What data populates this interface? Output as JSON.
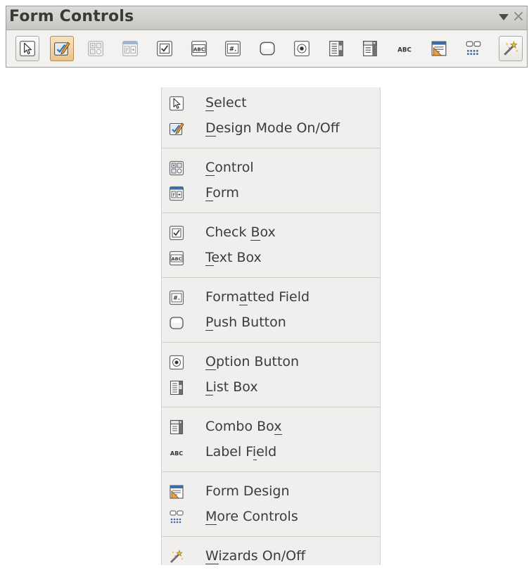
{
  "toolbar": {
    "title": "Form Controls",
    "menu_icon": "dropdown-arrow-icon",
    "close_icon": "close-icon",
    "buttons": [
      {
        "icon": "select-pointer-icon",
        "state": "normal"
      },
      {
        "icon": "design-mode-icon",
        "state": "pressed"
      },
      {
        "icon": "control-icon",
        "state": "disabled"
      },
      {
        "icon": "form-icon",
        "state": "disabled"
      },
      {
        "icon": "check-box-icon",
        "state": "normal"
      },
      {
        "icon": "text-box-icon",
        "state": "normal"
      },
      {
        "icon": "formatted-field-icon",
        "state": "normal"
      },
      {
        "icon": "push-button-icon",
        "state": "normal"
      },
      {
        "icon": "option-button-icon",
        "state": "normal"
      },
      {
        "icon": "list-box-icon",
        "state": "normal"
      },
      {
        "icon": "combo-box-icon",
        "state": "normal"
      },
      {
        "icon": "label-field-icon",
        "state": "normal"
      },
      {
        "icon": "form-design-icon",
        "state": "normal"
      },
      {
        "icon": "more-controls-icon",
        "state": "normal"
      },
      {
        "icon": "wizards-icon",
        "state": "boxed"
      }
    ],
    "label_field_glyph": "ABC",
    "text_box_glyph": "ABC"
  },
  "menu": {
    "items": [
      {
        "label": "Select",
        "icon": "select-pointer-icon",
        "mnemonic": "S"
      },
      {
        "label": "Design Mode On/Off",
        "icon": "design-mode-icon",
        "mnemonic": "D"
      },
      {
        "label": "Control",
        "icon": "control-icon",
        "mnemonic": "C"
      },
      {
        "label": "Form",
        "icon": "form-icon",
        "mnemonic": "F"
      },
      {
        "label": "Check Box",
        "icon": "check-box-icon",
        "mnemonic": "B"
      },
      {
        "label": "Text Box",
        "icon": "text-box-icon",
        "mnemonic": "T"
      },
      {
        "label": "Formatted Field",
        "icon": "formatted-field-icon",
        "mnemonic": "a"
      },
      {
        "label": "Push Button",
        "icon": "push-button-icon",
        "mnemonic": "P"
      },
      {
        "label": "Option Button",
        "icon": "option-button-icon",
        "mnemonic": "O"
      },
      {
        "label": "List Box",
        "icon": "list-box-icon",
        "mnemonic": "L"
      },
      {
        "label": "Combo Box",
        "icon": "combo-box-icon",
        "mnemonic": "x"
      },
      {
        "label": "Label Field",
        "icon": "label-field-icon",
        "mnemonic": "i"
      },
      {
        "label": "Form Design",
        "icon": "form-design-icon",
        "mnemonic": ""
      },
      {
        "label": "More Controls",
        "icon": "more-controls-icon",
        "mnemonic": "M"
      },
      {
        "label": "Wizards On/Off",
        "icon": "wizards-icon",
        "mnemonic": "W"
      }
    ]
  },
  "colors": {
    "accent_pressed": "#e9c48b",
    "icon_blue": "#3a6ea5",
    "icon_orange": "#e8a33d"
  }
}
